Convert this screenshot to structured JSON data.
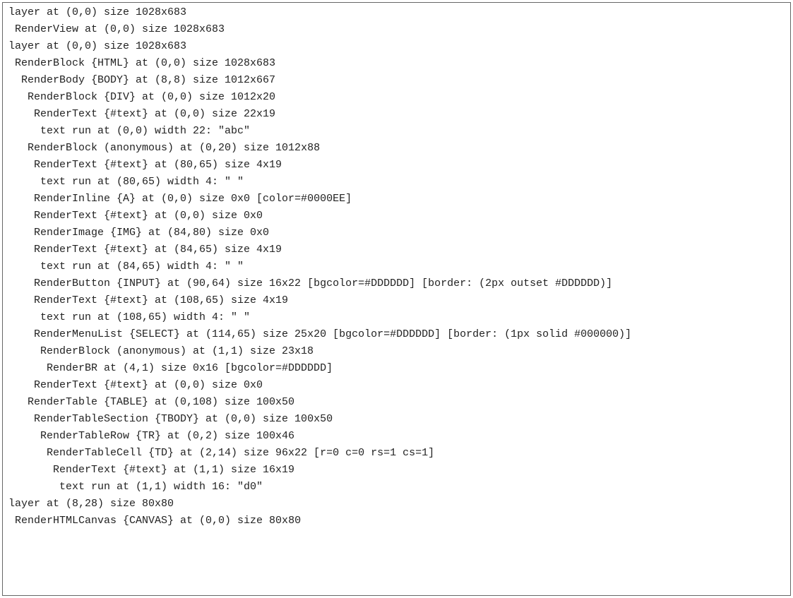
{
  "lines": [
    {
      "indent": 0,
      "text": "layer at (0,0) size 1028x683"
    },
    {
      "indent": 1,
      "text": "RenderView at (0,0) size 1028x683"
    },
    {
      "indent": 0,
      "text": "layer at (0,0) size 1028x683"
    },
    {
      "indent": 1,
      "text": "RenderBlock {HTML} at (0,0) size 1028x683"
    },
    {
      "indent": 2,
      "text": "RenderBody {BODY} at (8,8) size 1012x667"
    },
    {
      "indent": 3,
      "text": "RenderBlock {DIV} at (0,0) size 1012x20"
    },
    {
      "indent": 4,
      "text": "RenderText {#text} at (0,0) size 22x19"
    },
    {
      "indent": 5,
      "text": "text run at (0,0) width 22: \"abc\""
    },
    {
      "indent": 3,
      "text": "RenderBlock (anonymous) at (0,20) size 1012x88"
    },
    {
      "indent": 4,
      "text": "RenderText {#text} at (80,65) size 4x19"
    },
    {
      "indent": 5,
      "text": "text run at (80,65) width 4: \" \""
    },
    {
      "indent": 4,
      "text": "RenderInline {A} at (0,0) size 0x0 [color=#0000EE]"
    },
    {
      "indent": 4,
      "text": "RenderText {#text} at (0,0) size 0x0"
    },
    {
      "indent": 4,
      "text": "RenderImage {IMG} at (84,80) size 0x0"
    },
    {
      "indent": 4,
      "text": "RenderText {#text} at (84,65) size 4x19"
    },
    {
      "indent": 5,
      "text": "text run at (84,65) width 4: \" \""
    },
    {
      "indent": 4,
      "text": "RenderButton {INPUT} at (90,64) size 16x22 [bgcolor=#DDDDDD] [border: (2px outset #DDDDDD)]"
    },
    {
      "indent": 4,
      "text": "RenderText {#text} at (108,65) size 4x19"
    },
    {
      "indent": 5,
      "text": "text run at (108,65) width 4: \" \""
    },
    {
      "indent": 4,
      "text": "RenderMenuList {SELECT} at (114,65) size 25x20 [bgcolor=#DDDDDD] [border: (1px solid #000000)]"
    },
    {
      "indent": 5,
      "text": "RenderBlock (anonymous) at (1,1) size 23x18"
    },
    {
      "indent": 6,
      "text": "RenderBR at (4,1) size 0x16 [bgcolor=#DDDDDD]"
    },
    {
      "indent": 4,
      "text": "RenderText {#text} at (0,0) size 0x0"
    },
    {
      "indent": 3,
      "text": "RenderTable {TABLE} at (0,108) size 100x50"
    },
    {
      "indent": 4,
      "text": "RenderTableSection {TBODY} at (0,0) size 100x50"
    },
    {
      "indent": 5,
      "text": "RenderTableRow {TR} at (0,2) size 100x46"
    },
    {
      "indent": 6,
      "text": "RenderTableCell {TD} at (2,14) size 96x22 [r=0 c=0 rs=1 cs=1]"
    },
    {
      "indent": 7,
      "text": "RenderText {#text} at (1,1) size 16x19"
    },
    {
      "indent": 8,
      "text": "text run at (1,1) width 16: \"d0\""
    },
    {
      "indent": 0,
      "text": "layer at (8,28) size 80x80"
    },
    {
      "indent": 1,
      "text": "RenderHTMLCanvas {CANVAS} at (0,0) size 80x80"
    }
  ]
}
